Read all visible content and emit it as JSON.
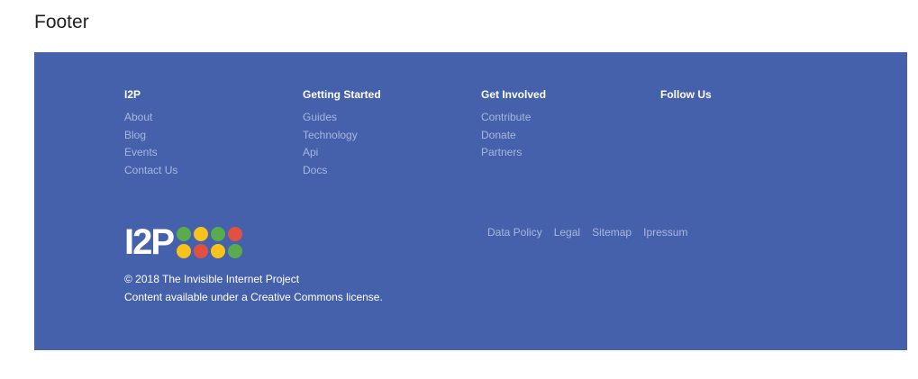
{
  "page": {
    "heading": "Footer"
  },
  "footer": {
    "columns": [
      {
        "title": "I2P",
        "links": [
          "About",
          "Blog",
          "Events",
          "Contact Us"
        ]
      },
      {
        "title": "Getting Started",
        "links": [
          "Guides",
          "Technology",
          "Api",
          "Docs"
        ]
      },
      {
        "title": "Get Involved",
        "links": [
          "Contribute",
          "Donate",
          "Partners"
        ]
      },
      {
        "title": "Follow Us",
        "links": []
      }
    ],
    "logo": {
      "text": "I2P",
      "dot_colors": [
        "#5aaa4e",
        "#f8c21c",
        "#5aaa4e",
        "#e25041",
        "#f8c21c",
        "#e25041",
        "#f8c21c",
        "#5aaa4e"
      ]
    },
    "copyright_line": "© 2018 The Invisible Internet Project",
    "license_line": "Content available under a Creative Commons license.",
    "legal_links": [
      "Data Policy",
      "Legal",
      "Sitemap",
      "Ipressum"
    ],
    "colors": {
      "background": "#4661ac",
      "link": "#a9b6dc",
      "heading": "#ffffff"
    }
  }
}
